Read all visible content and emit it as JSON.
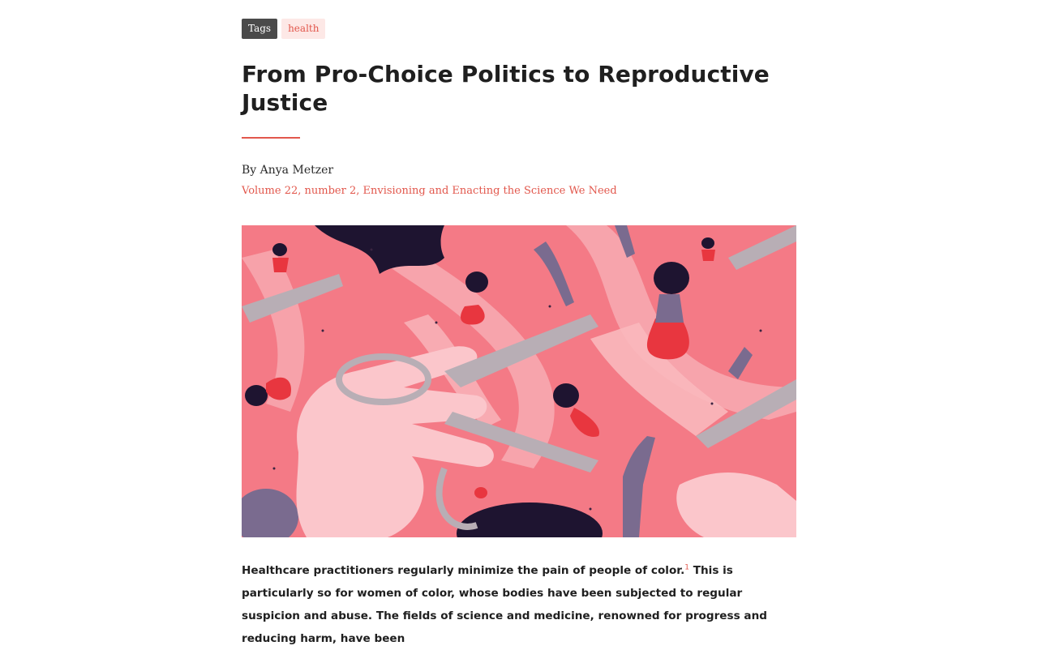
{
  "tags": {
    "label": "Tags",
    "items": [
      "health"
    ]
  },
  "article": {
    "title": "From Pro-Choice Politics to Reproductive Justice",
    "byline": "By Anya Metzer",
    "volume": "Volume 22, number 2, Envisioning and Enacting the Science We Need",
    "body": {
      "sentence_1": "Healthcare practitioners regularly minimize the pain of people of color.",
      "footnote": "1",
      "sentence_2": " This is particularly so for women of color, whose bodies have been subjected to regular suspicion and abuse. The fields of science and medicine, renowned for progress and reducing harm, have been"
    }
  },
  "colors": {
    "accent": "#e2574c",
    "tag_dark": "#4a4a4a",
    "tag_light": "#fde8e6",
    "illustration_bg": "#f47a86"
  },
  "icons": {
    "hero_image": "illustration-scissors-women"
  }
}
